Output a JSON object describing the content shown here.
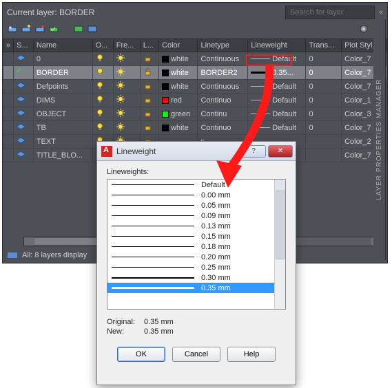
{
  "panel": {
    "title": "Current layer: BORDER",
    "search_placeholder": "Search for layer",
    "footer": "All: 8 layers display",
    "sidebar_label": "LAYER PROPERTIES MANAGER",
    "columns": [
      "S...",
      "Name",
      "O...",
      "Fre...",
      "L...",
      "Color",
      "Linetype",
      "Lineweight",
      "Trans...",
      "Plot Styl..."
    ]
  },
  "layers": [
    {
      "st": "",
      "name": "0",
      "color": "white",
      "swatch": "#000",
      "ltype": "Continuous",
      "lw": "Default",
      "tr": "0",
      "plot": "Color_7"
    },
    {
      "st": "cur",
      "name": "BORDER",
      "color": "white",
      "swatch": "#000",
      "ltype": "BORDER2",
      "lw": "0.35...",
      "tr": "0",
      "plot": "Color_7",
      "sel": true,
      "thick": true
    },
    {
      "st": "",
      "name": "Defpoints",
      "color": "white",
      "swatch": "#000",
      "ltype": "Continuous",
      "lw": "Default",
      "tr": "0",
      "plot": "Color_7"
    },
    {
      "st": "",
      "name": "DIMS",
      "color": "red",
      "swatch": "#ff0000",
      "ltype": "Continuo",
      "lw": "Default",
      "tr": "0",
      "plot": "Color_1"
    },
    {
      "st": "",
      "name": "OBJECT",
      "color": "green",
      "swatch": "#00ff00",
      "ltype": "Continu",
      "lw": "Default",
      "tr": "0",
      "plot": "Color_3"
    },
    {
      "st": "",
      "name": "TB",
      "color": "white",
      "swatch": "#000",
      "ltype": "Continuo",
      "lw": "Default",
      "tr": "0",
      "plot": "Color_7"
    },
    {
      "st": "",
      "name": "TEXT",
      "color": "",
      "swatch": "",
      "ltype": "s",
      "lw": "",
      "tr": "",
      "plot": "Color_2"
    },
    {
      "st": "",
      "name": "TITLE_BLO...",
      "color": "",
      "swatch": "",
      "ltype": "",
      "lw": "",
      "tr": "",
      "plot": "Color_7"
    }
  ],
  "dialog": {
    "title": "Lineweight",
    "list_label": "Lineweights:",
    "original_label": "Original:",
    "original_value": "0.35 mm",
    "new_label": "New:",
    "new_value": "0.35 mm",
    "ok": "OK",
    "cancel": "Cancel",
    "help": "Help"
  },
  "lineweights": [
    {
      "label": "Default",
      "w": 1
    },
    {
      "label": "0.00 mm",
      "w": 1
    },
    {
      "label": "0.05 mm",
      "w": 1
    },
    {
      "label": "0.09 mm",
      "w": 1
    },
    {
      "label": "0.13 mm",
      "w": 1
    },
    {
      "label": "0.15 mm",
      "w": 1
    },
    {
      "label": "0.18 mm",
      "w": 1
    },
    {
      "label": "0.20 mm",
      "w": 1
    },
    {
      "label": "0.25 mm",
      "w": 1
    },
    {
      "label": "0.30 mm",
      "w": 2
    },
    {
      "label": "0.35 mm",
      "w": 3,
      "sel": true
    }
  ]
}
